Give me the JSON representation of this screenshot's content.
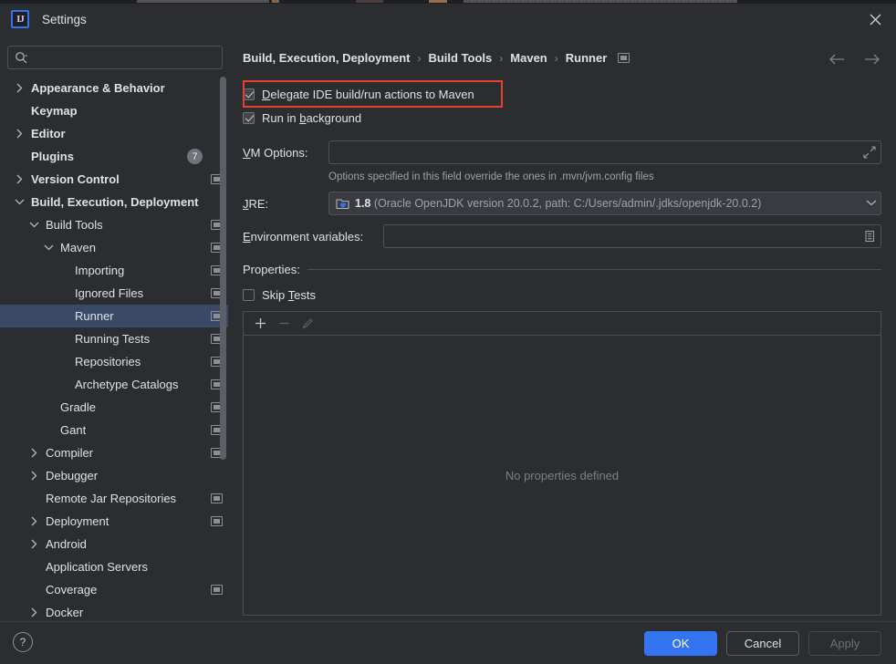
{
  "window": {
    "title": "Settings",
    "logo_text": "IJ",
    "close_icon": "close-icon"
  },
  "search": {
    "value": "",
    "placeholder": "",
    "icon": "search-icon"
  },
  "sidebar": {
    "items": [
      {
        "label": "Appearance & Behavior",
        "indent": 0,
        "arrow": "chevron-right",
        "bold": true,
        "project_icon": false,
        "badge": "",
        "selected": false
      },
      {
        "label": "Keymap",
        "indent": 0,
        "arrow": "none",
        "bold": true,
        "project_icon": false,
        "badge": "",
        "selected": false
      },
      {
        "label": "Editor",
        "indent": 0,
        "arrow": "chevron-right",
        "bold": true,
        "project_icon": false,
        "badge": "",
        "selected": false
      },
      {
        "label": "Plugins",
        "indent": 0,
        "arrow": "none",
        "bold": true,
        "project_icon": false,
        "badge": "7",
        "selected": false
      },
      {
        "label": "Version Control",
        "indent": 0,
        "arrow": "chevron-right",
        "bold": true,
        "project_icon": true,
        "badge": "",
        "selected": false
      },
      {
        "label": "Build, Execution, Deployment",
        "indent": 0,
        "arrow": "chevron-down",
        "bold": true,
        "project_icon": false,
        "badge": "",
        "selected": false
      },
      {
        "label": "Build Tools",
        "indent": 1,
        "arrow": "chevron-down",
        "bold": false,
        "project_icon": true,
        "badge": "",
        "selected": false
      },
      {
        "label": "Maven",
        "indent": 2,
        "arrow": "chevron-down",
        "bold": false,
        "project_icon": true,
        "badge": "",
        "selected": false
      },
      {
        "label": "Importing",
        "indent": 3,
        "arrow": "none",
        "bold": false,
        "project_icon": true,
        "badge": "",
        "selected": false
      },
      {
        "label": "Ignored Files",
        "indent": 3,
        "arrow": "none",
        "bold": false,
        "project_icon": true,
        "badge": "",
        "selected": false
      },
      {
        "label": "Runner",
        "indent": 3,
        "arrow": "none",
        "bold": false,
        "project_icon": true,
        "badge": "",
        "selected": true
      },
      {
        "label": "Running Tests",
        "indent": 3,
        "arrow": "none",
        "bold": false,
        "project_icon": true,
        "badge": "",
        "selected": false
      },
      {
        "label": "Repositories",
        "indent": 3,
        "arrow": "none",
        "bold": false,
        "project_icon": true,
        "badge": "",
        "selected": false
      },
      {
        "label": "Archetype Catalogs",
        "indent": 3,
        "arrow": "none",
        "bold": false,
        "project_icon": true,
        "badge": "",
        "selected": false
      },
      {
        "label": "Gradle",
        "indent": 2,
        "arrow": "none",
        "bold": false,
        "project_icon": true,
        "badge": "",
        "selected": false
      },
      {
        "label": "Gant",
        "indent": 2,
        "arrow": "none",
        "bold": false,
        "project_icon": true,
        "badge": "",
        "selected": false
      },
      {
        "label": "Compiler",
        "indent": 1,
        "arrow": "chevron-right",
        "bold": false,
        "project_icon": true,
        "badge": "",
        "selected": false
      },
      {
        "label": "Debugger",
        "indent": 1,
        "arrow": "chevron-right",
        "bold": false,
        "project_icon": false,
        "badge": "",
        "selected": false
      },
      {
        "label": "Remote Jar Repositories",
        "indent": 1,
        "arrow": "none",
        "bold": false,
        "project_icon": true,
        "badge": "",
        "selected": false
      },
      {
        "label": "Deployment",
        "indent": 1,
        "arrow": "chevron-right",
        "bold": false,
        "project_icon": true,
        "badge": "",
        "selected": false
      },
      {
        "label": "Android",
        "indent": 1,
        "arrow": "chevron-right",
        "bold": false,
        "project_icon": false,
        "badge": "",
        "selected": false
      },
      {
        "label": "Application Servers",
        "indent": 1,
        "arrow": "none",
        "bold": false,
        "project_icon": false,
        "badge": "",
        "selected": false
      },
      {
        "label": "Coverage",
        "indent": 1,
        "arrow": "none",
        "bold": false,
        "project_icon": true,
        "badge": "",
        "selected": false
      },
      {
        "label": "Docker",
        "indent": 1,
        "arrow": "chevron-right",
        "bold": false,
        "project_icon": false,
        "badge": "",
        "selected": false
      }
    ]
  },
  "main": {
    "breadcrumb": [
      "Build, Execution, Deployment",
      "Build Tools",
      "Maven",
      "Runner"
    ],
    "breadcrumb_separator": "›",
    "nav_back_icon": "arrow-left-icon",
    "nav_forward_icon": "arrow-right-icon",
    "delegate": {
      "label_mnemonic": "D",
      "label_rest": "elegate IDE build/run actions to Maven",
      "checked": true
    },
    "run_in_background": {
      "label_pre": "Run in ",
      "label_mnemonic": "b",
      "label_rest": "ackground",
      "checked": true
    },
    "vm_options": {
      "label_pre": "",
      "label_mnemonic": "V",
      "label_rest": "M Options:",
      "value": "",
      "placeholder": "",
      "expand_icon": "expand-icon"
    },
    "vm_hint": "Options specified in this field override the ones in .mvn/jvm.config files",
    "jre": {
      "label_mnemonic": "J",
      "label_rest": "RE:",
      "icon": "jdk-folder-icon",
      "version": "1.8",
      "detail": "(Oracle OpenJDK version 20.0.2, path: C:/Users/admin/.jdks/openjdk-20.0.2)",
      "caret_icon": "chevron-down-icon"
    },
    "env_vars": {
      "label_mnemonic": "E",
      "label_rest": "nvironment variables:",
      "value": "",
      "placeholder": "",
      "browse_icon": "list-edit-icon"
    },
    "properties": {
      "section_label": "Properties:",
      "skip_tests": {
        "label_pre": "Skip ",
        "label_mnemonic": "T",
        "label_rest": "ests",
        "checked": false
      },
      "toolbar": {
        "add_icon": "plus-icon",
        "remove_icon": "minus-icon",
        "edit_icon": "pencil-icon"
      },
      "empty_text": "No properties defined"
    }
  },
  "footer": {
    "help_label": "?",
    "ok_label": "OK",
    "cancel_label": "Cancel",
    "apply_label": "Apply"
  },
  "colors": {
    "accent": "#3574f0",
    "selection": "#3a4a66",
    "highlight": "#e8422f",
    "panel_bg": "#2b2d30"
  }
}
